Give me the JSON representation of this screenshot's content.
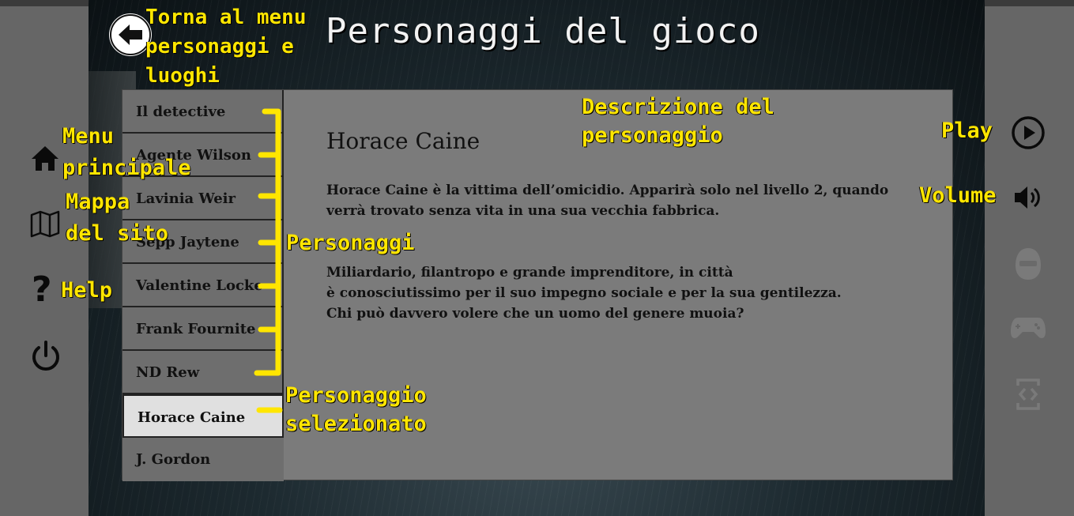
{
  "page": {
    "title": "Personaggi del gioco"
  },
  "characters": [
    {
      "label": "Il detective"
    },
    {
      "label": "Agente Wilson"
    },
    {
      "label": "Lavinia Weir"
    },
    {
      "label": "Sepp Jaytene"
    },
    {
      "label": "Valentine Locke"
    },
    {
      "label": "Frank Fournite"
    },
    {
      "label": "ND Rew"
    },
    {
      "label": "Horace Caine",
      "selected": true
    },
    {
      "label": "J. Gordon"
    }
  ],
  "detail": {
    "name": "Horace Caine",
    "paragraph1": "Horace Caine è la vittima dell’omicidio. Apparirà solo nel livello 2, quando verrà trovato senza vita in una sua vecchia fabbrica.",
    "paragraph2": "Miliardario, filantropo e grande imprenditore, in città\nè conosciutissimo per il suo impegno sociale e per la sua gentilezza.\nChi può davvero volere che un uomo del genere muoia?"
  },
  "icons": {
    "left": [
      "back-arrow-icon",
      "home-icon",
      "map-icon",
      "help-icon",
      "power-icon"
    ],
    "right": [
      "play-icon",
      "volume-icon",
      "avatar-icon",
      "gamepad-icon",
      "fullscreen-icon"
    ]
  },
  "annotations": {
    "back": "Torna al menu personaggi e luoghi",
    "description": "Descrizione del personaggio",
    "play": "Play",
    "volume": "Volume",
    "menu": "Menu principale",
    "map": "Mappa del sito",
    "help": "Help",
    "characters": "Personaggi",
    "selected": "Personaggio selezionato"
  },
  "colors": {
    "annotation": "#ffe600",
    "panel": "#7b7b7b",
    "selected_item": "#e0e0e0",
    "side_panel": "#666666"
  }
}
